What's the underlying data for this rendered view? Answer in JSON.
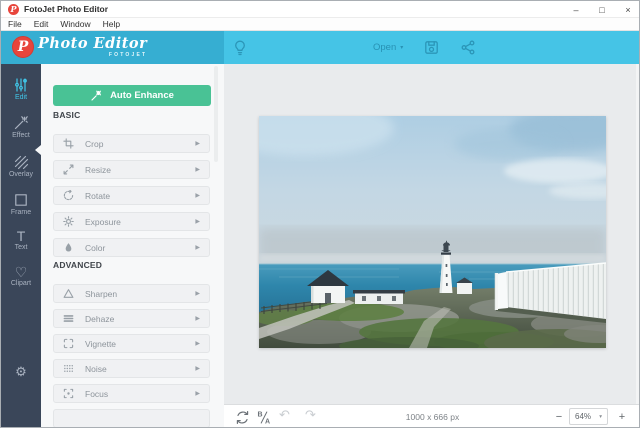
{
  "window": {
    "title": "FotoJet Photo Editor",
    "minimize": "–",
    "maximize": "□",
    "close": "×"
  },
  "menu": {
    "items": [
      "File",
      "Edit",
      "Window",
      "Help"
    ]
  },
  "header": {
    "logo_monogram": "P",
    "logo_script": "Photo Editor",
    "logo_sub": "FOTOJET",
    "open_label": "Open"
  },
  "icons": {
    "caret_down": "▾",
    "chevron_right": "▶",
    "heart": "♡",
    "gear": "⚙",
    "text_tool": "T",
    "undo": "↶",
    "redo": "↷",
    "minus": "−",
    "plus": "+"
  },
  "sidebar": {
    "items": [
      {
        "label": "Edit",
        "icon": "sliders-icon",
        "active": true
      },
      {
        "label": "Effect",
        "icon": "magic-wand-icon",
        "active": false
      },
      {
        "label": "Overlay",
        "icon": "diagonal-hatch-icon",
        "active": false
      },
      {
        "label": "Frame",
        "icon": "frame-icon",
        "active": false
      },
      {
        "label": "Text",
        "icon": "text-icon",
        "active": false
      },
      {
        "label": "Clipart",
        "icon": "heart-icon",
        "active": false
      }
    ]
  },
  "panel": {
    "auto_enhance": "Auto Enhance",
    "sections": [
      {
        "title": "BASIC",
        "tools": [
          "Crop",
          "Resize",
          "Rotate",
          "Exposure",
          "Color"
        ]
      },
      {
        "title": "ADVANCED",
        "tools": [
          "Sharpen",
          "Dehaze",
          "Vignette",
          "Noise",
          "Focus"
        ]
      }
    ]
  },
  "statusbar": {
    "before_label": "B",
    "after_label": "A",
    "dimensions": "1000 x 666 px",
    "zoom": "64%"
  },
  "colors": {
    "header_teal": "#45c4e6",
    "header_teal_dark": "#36aed2",
    "header_icon_teal": "#2b96b8",
    "sidebar_navy": "#3a4659",
    "accent_active": "#41c8ea",
    "enhance_green": "#49c295",
    "logo_red": "#e8453c",
    "canvas_gray": "#e9ebed",
    "panel_bg": "#f7f8f9"
  }
}
